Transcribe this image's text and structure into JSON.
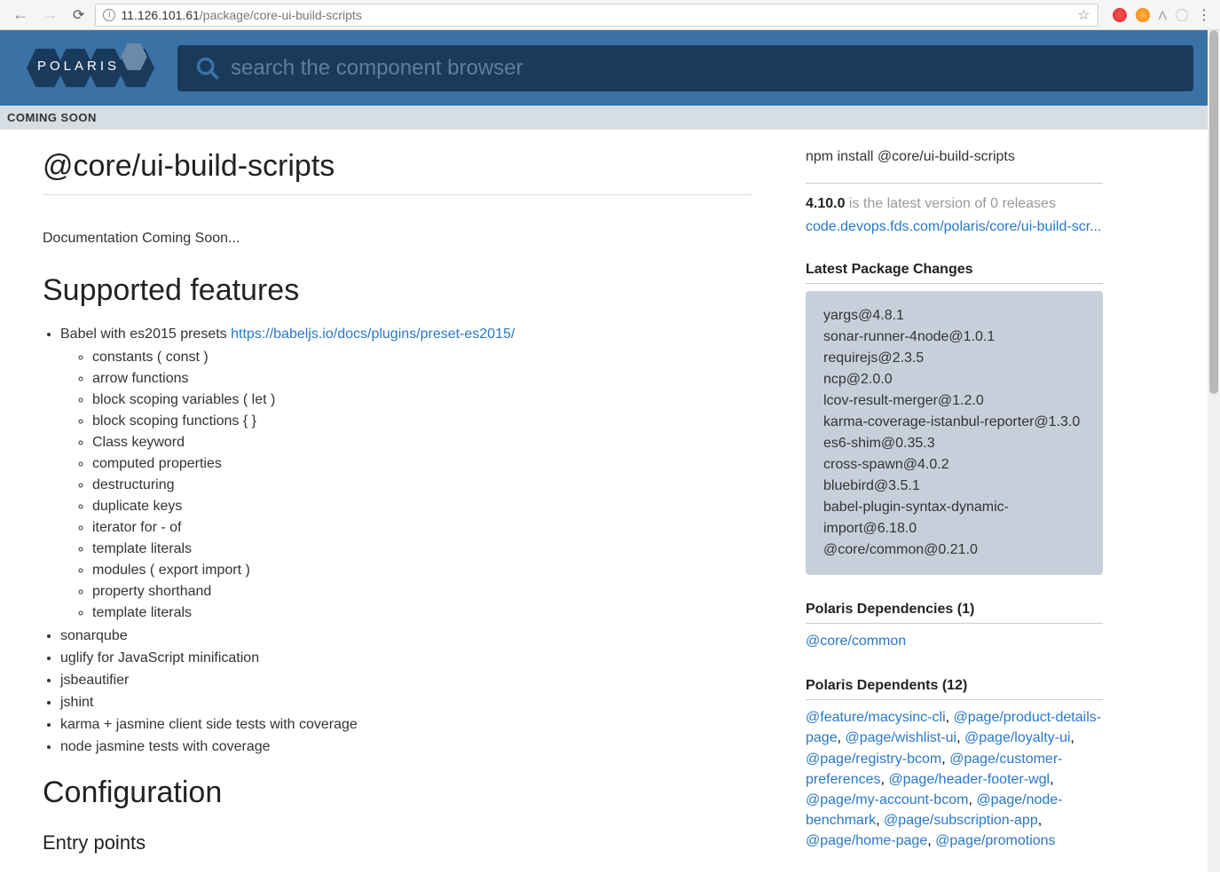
{
  "browser": {
    "url_host": "11.126.101.61",
    "url_path": "/package/core-ui-build-scripts"
  },
  "header": {
    "logo_text": "POLARIS",
    "search_placeholder": "search the component browser"
  },
  "banner": "COMING SOON",
  "page": {
    "title": "@core/ui-build-scripts",
    "doc_coming": "Documentation Coming Soon...",
    "features_heading": "Supported features",
    "config_heading": "Configuration",
    "entry_points_heading": "Entry points",
    "babel_text": "Babel with es2015 presets ",
    "babel_link": "https://babeljs.io/docs/plugins/preset-es2015/",
    "babel_features": [
      "constants ( const )",
      "arrow functions",
      "block scoping variables ( let )",
      "block scoping functions { }",
      "Class keyword",
      "computed properties",
      "destructuring",
      "duplicate keys",
      "iterator for - of",
      "template literals",
      "modules ( export import )",
      "property shorthand",
      "template literals"
    ],
    "other_features": [
      "sonarqube",
      "uglify for JavaScript minification",
      "jsbeautifier",
      "jshint",
      "karma + jasmine client side tests with coverage",
      "node jasmine tests with coverage"
    ]
  },
  "sidebar": {
    "install_cmd": "npm install @core/ui-build-scripts",
    "version": "4.10.0",
    "version_suffix": " is the latest version of 0 releases",
    "repo_link": "code.devops.fds.com/polaris/core/ui-build-scr...",
    "changes_heading": "Latest Package Changes",
    "changes": [
      "yargs@4.8.1",
      "sonar-runner-4node@1.0.1",
      "requirejs@2.3.5",
      "ncp@2.0.0",
      "lcov-result-merger@1.2.0",
      "karma-coverage-istanbul-reporter@1.3.0",
      "es6-shim@0.35.3",
      "cross-spawn@4.0.2",
      "bluebird@3.5.1",
      "babel-plugin-syntax-dynamic-import@6.18.0",
      "@core/common@0.21.0"
    ],
    "deps_heading": "Polaris Dependencies (1)",
    "deps": [
      "@core/common"
    ],
    "dependents_heading": "Polaris Dependents (12)",
    "dependents": [
      "@feature/macysinc-cli",
      "@page/product-details-page",
      "@page/wishlist-ui",
      "@page/loyalty-ui",
      "@page/registry-bcom",
      "@page/customer-preferences",
      "@page/header-footer-wgl",
      "@page/my-account-bcom",
      "@page/node-benchmark",
      "@page/subscription-app",
      "@page/home-page",
      "@page/promotions"
    ]
  }
}
